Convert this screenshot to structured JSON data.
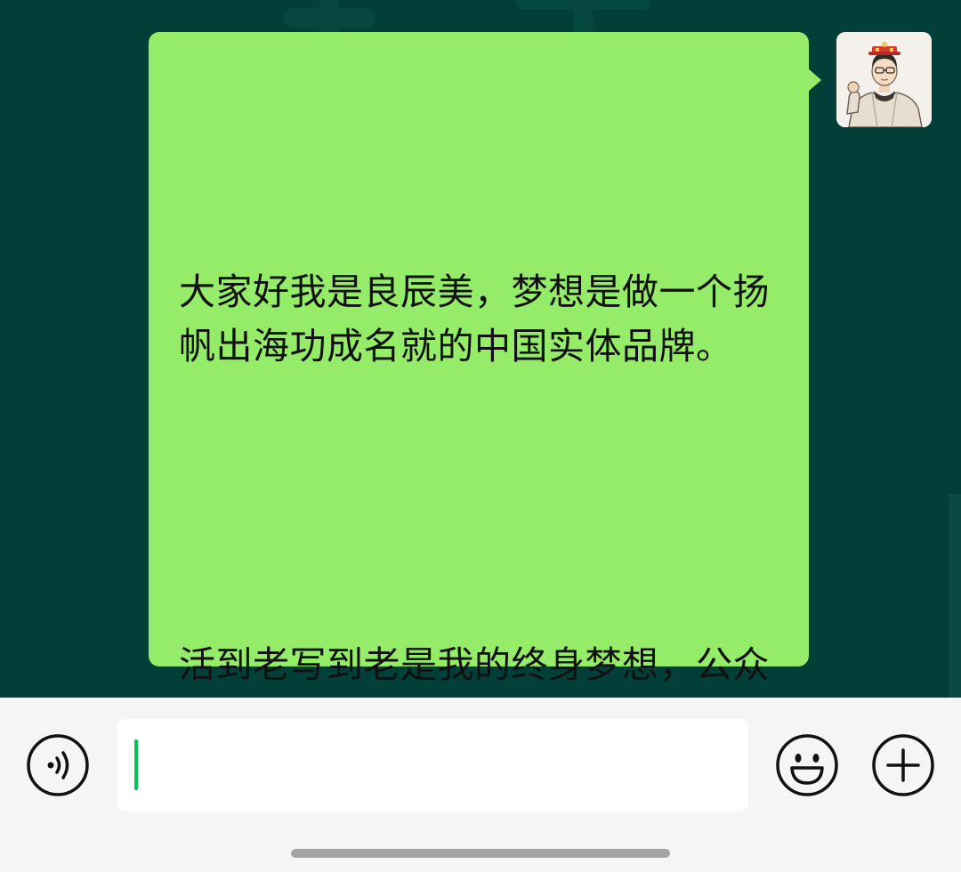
{
  "chat": {
    "message": {
      "paragraph_1": "大家好我是良辰美，梦想是做一个扬帆出海功成名就的中国实体品牌。",
      "paragraph_2": "活到老写到老是我的终身梦想，公众号日更是我的人生原则，真诚利他是我的为人准则。"
    },
    "avatar_icon": "user-avatar",
    "bubble_color": "#95ec69",
    "background_color": "#023f38"
  },
  "input_bar": {
    "voice_icon": "voice-icon",
    "emoji_icon": "emoji-icon",
    "plus_icon": "plus-icon",
    "text_value": "",
    "caret_color": "#07c160"
  }
}
